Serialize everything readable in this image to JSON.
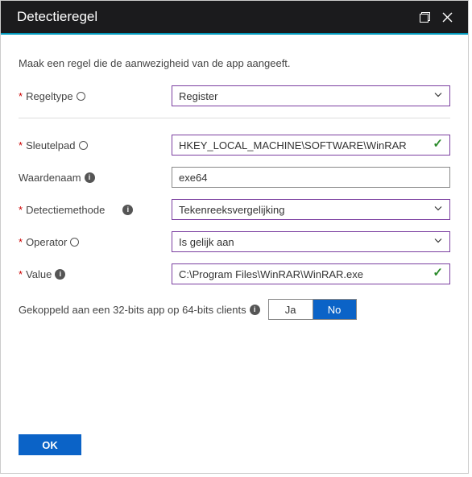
{
  "titlebar": {
    "title": "Detectieregel"
  },
  "intro": "Maak een regel die de aanwezigheid van de app aangeeft.",
  "fields": {
    "ruleType": {
      "label": "Regeltype",
      "value": "Register"
    },
    "keyPath": {
      "label": "Sleutelpad",
      "value": "HKEY_LOCAL_MACHINE\\SOFTWARE\\WinRAR"
    },
    "valueName": {
      "label": "Waardenaam",
      "value": "exe64"
    },
    "method": {
      "label": "Detectiemethode",
      "value": "Tekenreeksvergelijking"
    },
    "operator": {
      "label": "Operator",
      "value": "Is gelijk aan"
    },
    "value": {
      "label": "Value",
      "value": "C:\\Program Files\\WinRAR\\WinRAR.exe"
    }
  },
  "assoc": {
    "label": "Gekoppeld aan een 32-bits app op 64-bits clients",
    "yes": "Ja",
    "no": "No"
  },
  "footer": {
    "ok": "OK"
  }
}
